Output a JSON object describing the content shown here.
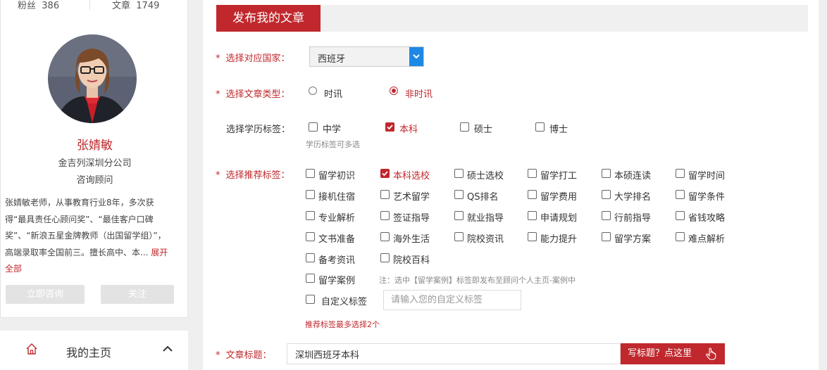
{
  "profile": {
    "fans_label": "粉丝",
    "fans_count": "386",
    "articles_label": "文章",
    "articles_count": "1749",
    "name": "张婧敏",
    "company": "金吉列深圳分公司",
    "role": "咨询顾问",
    "bio": "张婧敏老师，从事教育行业8年，多次获得“最具责任心顾问奖”、“最佳客户口碑奖”、“新浪五星金牌教师（出国留学组）”，高端录取率全国前三。擅长高中、本...",
    "expand_label": "展开全部",
    "consult_label": "立即咨询",
    "follow_label": "关注"
  },
  "nav": {
    "home_label": "我的主页"
  },
  "form": {
    "section_title": "发布我的文章",
    "country_label": "选择对应国家：",
    "country_value": "西班牙",
    "type_label": "选择文章类型：",
    "type_options": [
      "时讯",
      "非时讯"
    ],
    "type_selected": "非时讯",
    "edu_label": "选择学历标签：",
    "edu_options": [
      "中学",
      "本科",
      "硕士",
      "博士"
    ],
    "edu_checked": [
      "本科"
    ],
    "edu_hint": "学历标签可多选",
    "tags_label": "选择推荐标签：",
    "tags": [
      "留学初识",
      "本科选校",
      "硕士选校",
      "留学打工",
      "本硕连读",
      "留学时间",
      "接机住宿",
      "艺术留学",
      "QS排名",
      "留学费用",
      "大学排名",
      "留学条件",
      "专业解析",
      "签证指导",
      "就业指导",
      "申请规划",
      "行前指导",
      "省钱攻略",
      "文书准备",
      "海外生活",
      "院校资讯",
      "能力提升",
      "留学方案",
      "难点解析",
      "备考资讯",
      "院校百科"
    ],
    "tags_checked": [
      "本科选校"
    ],
    "case_label": "留学案例",
    "case_note": "注：选中【留学案例】标签即发布至顾问个人主页-案例中",
    "custom_label": "自定义标签",
    "custom_placeholder": "请输入您的自定义标签",
    "tags_limit_hint": "推荐标签最多选择2个",
    "title_label": "文章标题：",
    "title_value": "深圳西班牙本科",
    "title_button": "写标题？点这里"
  }
}
